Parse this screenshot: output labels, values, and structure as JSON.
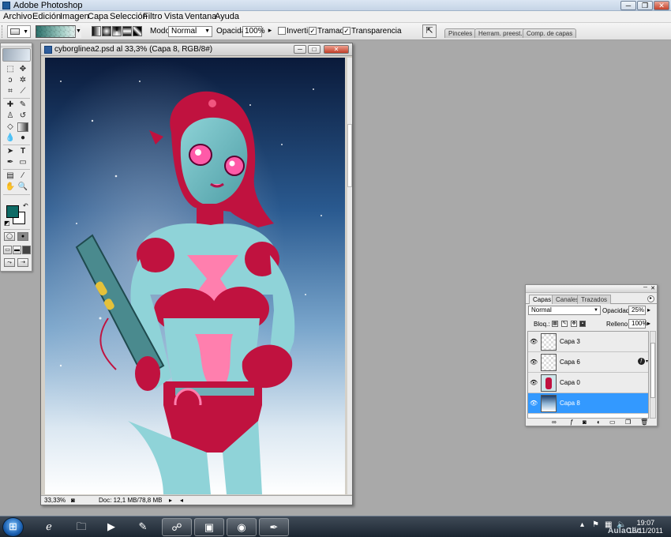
{
  "app": {
    "title": "Adobe Photoshop"
  },
  "window_buttons": {
    "minimize": "─",
    "restore": "❐",
    "close": "✕"
  },
  "menu": [
    "Archivo",
    "Edición",
    "Imagen",
    "Capa",
    "Selección",
    "Filtro",
    "Vista",
    "Ventana",
    "Ayuda"
  ],
  "options": {
    "mode_label": "Modo:",
    "mode_value": "Normal",
    "opacity_label": "Opacidad:",
    "opacity_value": "100%",
    "invert_label": "Invertir",
    "invert_checked": false,
    "dither_label": "Tramado",
    "dither_checked": true,
    "transparency_label": "Transparencia",
    "transparency_checked": true,
    "gradient_colors": [
      "#2a6f69",
      "#ffffff"
    ]
  },
  "palette_well": [
    "Pinceles",
    "Herram. preest.",
    "Comp. de capas"
  ],
  "toolbox": {
    "foreground_color": "#0f6b66",
    "background_color": "#ffffff",
    "active_tool": "gradient-tool"
  },
  "document": {
    "title": "cyborglinea2.psd al 33,3% (Capa 8, RGB/8#)",
    "zoom": "33,33%",
    "doc_info": "Doc: 12,1 MB/78,8 MB"
  },
  "layers_panel": {
    "tabs": [
      "Capas",
      "Canales",
      "Trazados"
    ],
    "active_tab": "Capas",
    "blend_mode": "Normal",
    "opacity_label": "Opacidad:",
    "opacity_value": "25%",
    "lock_label": "Bloq.:",
    "fill_label": "Relleno:",
    "fill_value": "100%",
    "layers": [
      {
        "name": "Capa 3",
        "visible": true,
        "selected": false,
        "has_effect": false
      },
      {
        "name": "Capa 6",
        "visible": true,
        "selected": false,
        "has_effect": true
      },
      {
        "name": "Capa 0",
        "visible": true,
        "selected": false,
        "has_effect": false
      },
      {
        "name": "Capa 8",
        "visible": true,
        "selected": true,
        "has_effect": false
      }
    ]
  },
  "taskbar": {
    "clock_time": "19:07",
    "clock_date": "16/11/2011",
    "watermark": "AulaClic"
  }
}
